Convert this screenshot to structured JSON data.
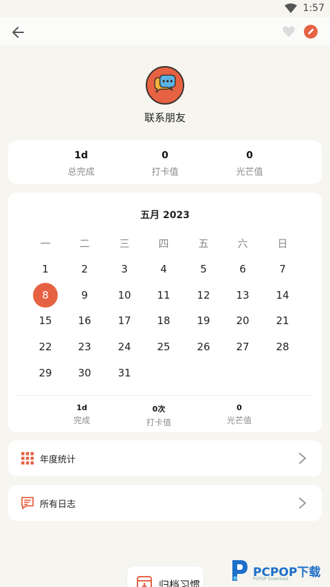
{
  "status_bar": {
    "time": "1:57"
  },
  "habit": {
    "title": "联系朋友"
  },
  "stats": [
    {
      "value": "1d",
      "label": "总完成"
    },
    {
      "value": "0",
      "label": "打卡值"
    },
    {
      "value": "0",
      "label": "光芒值"
    }
  ],
  "calendar": {
    "title": "五月 2023",
    "weekdays": [
      "一",
      "二",
      "三",
      "四",
      "五",
      "六",
      "日"
    ],
    "days": [
      [
        "1",
        "2",
        "3",
        "4",
        "5",
        "6",
        "7"
      ],
      [
        "8",
        "9",
        "10",
        "11",
        "12",
        "13",
        "14"
      ],
      [
        "15",
        "16",
        "17",
        "18",
        "19",
        "20",
        "21"
      ],
      [
        "22",
        "23",
        "24",
        "25",
        "26",
        "27",
        "28"
      ],
      [
        "29",
        "30",
        "31"
      ]
    ],
    "selected_day": "8",
    "month_stats": [
      {
        "value": "1d",
        "label": "完成"
      },
      {
        "value": "0次",
        "label": "打卡值"
      },
      {
        "value": "0",
        "label": "光芒值"
      }
    ]
  },
  "menu": {
    "yearly_label": "年度统计",
    "diary_label": "所有日志"
  },
  "archive": {
    "label": "归档习惯"
  },
  "watermark": {
    "brand": "PCPOP下载",
    "sub": "PCPOP Download"
  },
  "colors": {
    "accent": "#e66243",
    "background": "#f6f5f0",
    "card": "#ffffff"
  }
}
